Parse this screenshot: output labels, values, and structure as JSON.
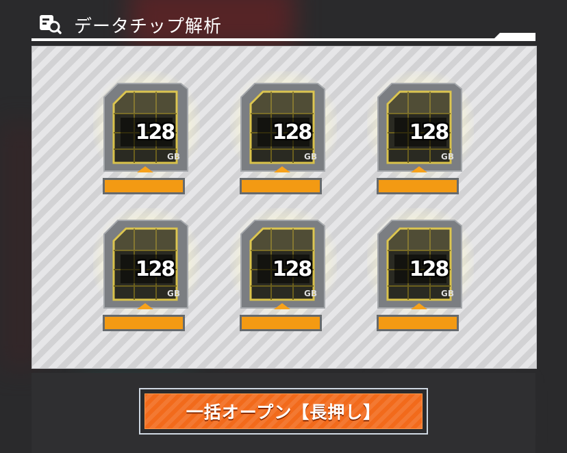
{
  "header": {
    "title": "データチップ解析",
    "icon": "magnifier-chip-icon"
  },
  "chips": [
    {
      "capacity": "128",
      "unit": "GB"
    },
    {
      "capacity": "128",
      "unit": "GB"
    },
    {
      "capacity": "128",
      "unit": "GB"
    },
    {
      "capacity": "128",
      "unit": "GB"
    },
    {
      "capacity": "128",
      "unit": "GB"
    },
    {
      "capacity": "128",
      "unit": "GB"
    }
  ],
  "actions": {
    "open_all_label": "一括オープン【長押し】"
  },
  "colors": {
    "accent_orange": "#f39a13",
    "button_orange": "#f26a1b",
    "chip_gold": "#d4b42a",
    "panel_gray": "#d9d9db"
  }
}
